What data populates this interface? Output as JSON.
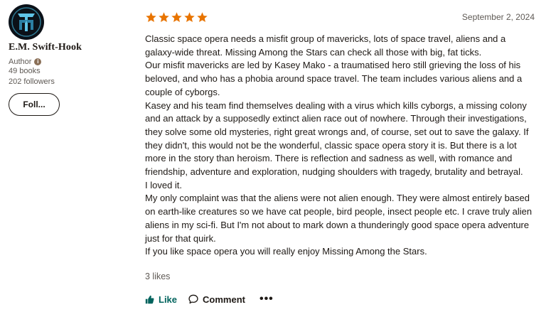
{
  "reviewer": {
    "name": "E.M. Swift-Hook",
    "role": "Author",
    "books": "49 books",
    "followers": "202 followers",
    "follow_label": "Foll..."
  },
  "review": {
    "rating": 5,
    "rating_max": 5,
    "star_color": "#e87400",
    "date": "September 2, 2024",
    "paragraphs": [
      "Classic space opera needs a misfit group of mavericks, lots of space travel, aliens and a galaxy-wide threat. Missing Among the Stars can check all those with big, fat ticks.",
      "Our misfit mavericks are led by Kasey Mako - a traumatised hero still grieving the loss of his beloved, and who has a phobia around space travel. The team includes various aliens and a couple of cyborgs.",
      "Kasey and his team find themselves dealing with a virus which kills cyborgs, a missing colony and an attack by a supposedly extinct alien race out of nowhere. Through their investigations, they solve some old mysteries, right great wrongs and, of course, set out to save the galaxy. If they didn't, this would not be the wonderful, classic space opera story it is. But there is a lot more in the story than heroism. There is reflection and sadness as well, with romance and friendship, adventure and exploration, nudging shoulders with tragedy, brutality and betrayal.",
      "I loved it.",
      "My only complaint was that the aliens were not alien enough. They were almost entirely based on earth-like creatures so we have cat people, bird people, insect people etc. I crave truly alien aliens in my sci-fi. But I'm not about to mark down a thunderingly good space opera adventure just for that quirk.",
      "If you like space opera you will really enjoy Missing Among the Stars."
    ],
    "likes": "3 likes"
  },
  "actions": {
    "like_label": "Like",
    "comment_label": "Comment",
    "more_label": "•••",
    "like_color": "#00635d"
  },
  "icons": {
    "avatar": "author-logo-avatar",
    "info": "info-icon",
    "star": "star-icon",
    "like": "thumbs-up-icon",
    "comment": "comment-bubble-icon",
    "more": "more-options-icon"
  }
}
